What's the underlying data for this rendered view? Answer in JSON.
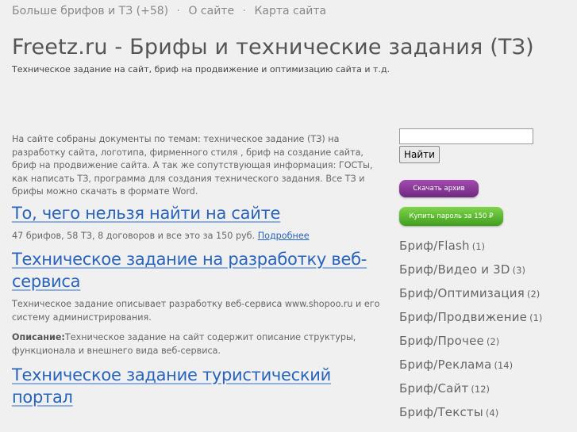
{
  "topnav": {
    "items": [
      "Больше брифов и ТЗ (+58)",
      "О сайте",
      "Карта сайта"
    ],
    "separator": "·"
  },
  "header": {
    "title": "Freetz.ru - Брифы и технические задания (ТЗ)",
    "subtitle": "Техническое задание на сайт, бриф на продвижение и оптимизацию сайта и т.д."
  },
  "main": {
    "intro": "На сайте собраны документы по темам: техническое задание (ТЗ) на разработку сайта, логотипа, фирменного стиля , бриф на создание сайта, бриф на продвижение сайта. А так же сопутствующая информация: ГОСТы, как написать ТЗ, программа для создания технического задания. Все ТЗ и брифы можно скачать в формате Word.",
    "posts": [
      {
        "title": "То, чего нельзя найти на сайте",
        "text": "47 брифов, 58 ТЗ, 8 договоров и все это за 150 руб.",
        "more": "Подробнее"
      },
      {
        "title": "Техническое задание на разработку веб-сервиса",
        "text": "Техническое задание описывает разработку веб-сервиса www.shopoo.ru и его систему администрирования.",
        "desc_label": "Описание:",
        "desc_text": "Техническое задание на сайт содержит описание структуры, функционала и внешнего вида веб-сервиса."
      },
      {
        "title": "Техническое задание туристический портал"
      }
    ]
  },
  "sidebar": {
    "search_value": "",
    "search_button": "Найти",
    "archive_button": "Скачать архив",
    "password_button": "Купить пароль за 150 ₽",
    "categories": [
      {
        "name": "Бриф/Flash",
        "count": "(1)"
      },
      {
        "name": "Бриф/Видео и 3D",
        "count": "(3)"
      },
      {
        "name": "Бриф/Оптимизация",
        "count": "(2)"
      },
      {
        "name": "Бриф/Продвижение",
        "count": "(1)"
      },
      {
        "name": "Бриф/Прочее",
        "count": "(2)"
      },
      {
        "name": "Бриф/Реклама",
        "count": "(14)"
      },
      {
        "name": "Бриф/Сайт",
        "count": "(12)"
      },
      {
        "name": "Бриф/Тексты",
        "count": "(4)"
      }
    ]
  },
  "colors": {
    "background": "#f0f0f0",
    "link": "#2864bd",
    "archive_button": "#8a3a9a",
    "password_button": "#5cb82f"
  }
}
